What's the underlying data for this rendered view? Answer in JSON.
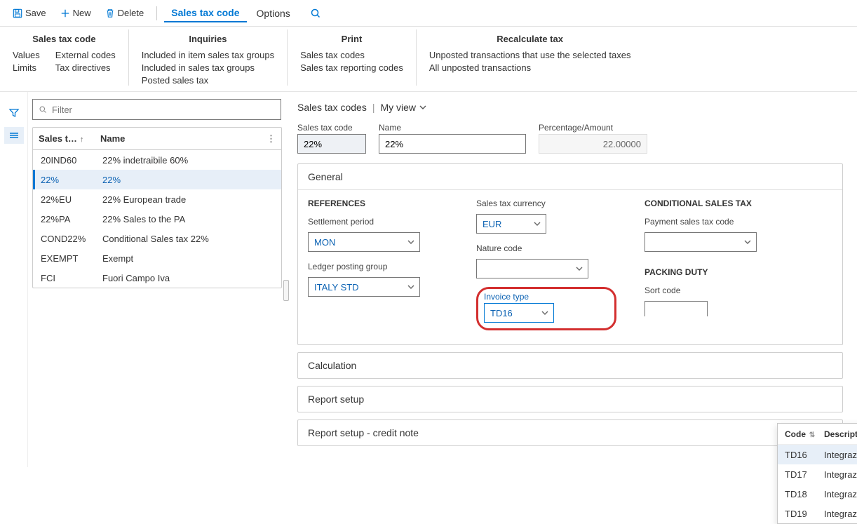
{
  "toolbar": {
    "save": "Save",
    "new": "New",
    "delete": "Delete",
    "tabs": [
      "Sales tax code",
      "Options"
    ]
  },
  "ribbon": {
    "groups": [
      {
        "title": "Sales tax code",
        "cols": [
          [
            "Values",
            "Limits"
          ],
          [
            "External codes",
            "Tax directives"
          ]
        ]
      },
      {
        "title": "Inquiries",
        "cols": [
          [
            "Included in item sales tax groups",
            "Included in sales tax groups",
            "Posted sales tax"
          ]
        ]
      },
      {
        "title": "Print",
        "cols": [
          [
            "Sales tax codes",
            "Sales tax reporting codes"
          ]
        ]
      },
      {
        "title": "Recalculate tax",
        "cols": [
          [
            "Unposted transactions that use the selected taxes",
            "All unposted transactions"
          ]
        ]
      }
    ]
  },
  "list": {
    "filter_placeholder": "Filter",
    "col1": "Sales t…",
    "col2": "Name",
    "rows": [
      {
        "code": "20IND60",
        "name": "22% indetraibile 60%",
        "selected": false
      },
      {
        "code": "22%",
        "name": "22%",
        "selected": true
      },
      {
        "code": "22%EU",
        "name": "22% European trade",
        "selected": false
      },
      {
        "code": "22%PA",
        "name": "22% Sales to the PA",
        "selected": false
      },
      {
        "code": "COND22%",
        "name": "Conditional Sales tax 22%",
        "selected": false
      },
      {
        "code": "EXEMPT",
        "name": "Exempt",
        "selected": false
      },
      {
        "code": "FCI",
        "name": "Fuori Campo Iva",
        "selected": false
      }
    ]
  },
  "crumb": {
    "title": "Sales tax codes",
    "view": "My view"
  },
  "header_fields": {
    "code_label": "Sales tax code",
    "code_value": "22%",
    "name_label": "Name",
    "name_value": "22%",
    "pct_label": "Percentage/Amount",
    "pct_value": "22.00000"
  },
  "general": {
    "title": "General",
    "references": {
      "title": "REFERENCES",
      "settlement_label": "Settlement period",
      "settlement_value": "MON",
      "ledger_label": "Ledger posting group",
      "ledger_value": "ITALY STD"
    },
    "col2": {
      "currency_label": "Sales tax currency",
      "currency_value": "EUR",
      "nature_label": "Nature code",
      "nature_value": "",
      "invoice_label": "Invoice type",
      "invoice_value": "TD16"
    },
    "conditional": {
      "title": "CONDITIONAL SALES TAX",
      "payment_label": "Payment sales tax code",
      "payment_value": "",
      "packing_title": "PACKING DUTY",
      "sort_label": "Sort code"
    }
  },
  "fasttabs": {
    "calc": "Calculation",
    "report": "Report setup",
    "credit": "Report setup - credit note"
  },
  "flyout": {
    "col_code": "Code",
    "col_desc": "Description",
    "rows": [
      {
        "code": "TD16",
        "desc": "Integrazione fattura reverse charge i…",
        "selected": true
      },
      {
        "code": "TD17",
        "desc": "Integrazione/autofattura per acquist…",
        "selected": false
      },
      {
        "code": "TD18",
        "desc": "Integrazione per acquisto di beni intr…",
        "selected": false
      },
      {
        "code": "TD19",
        "desc": "Integrazione/autofattura per acquist…",
        "selected": false
      }
    ]
  }
}
